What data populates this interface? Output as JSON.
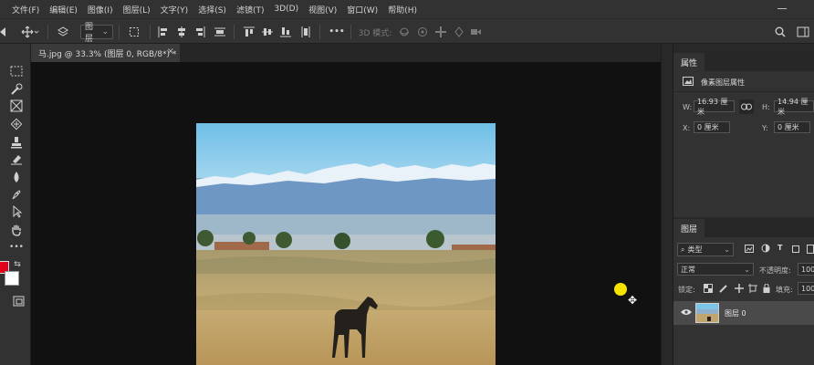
{
  "menubar": {
    "items": [
      "文件(F)",
      "编辑(E)",
      "图像(I)",
      "图层(L)",
      "文字(Y)",
      "选择(S)",
      "滤镜(T)",
      "3D(D)",
      "视图(V)",
      "窗口(W)",
      "帮助(H)"
    ]
  },
  "optionsbar": {
    "target_value": "图层",
    "mode_3d_label": "3D 模式:",
    "more_label": "•••"
  },
  "document": {
    "tab_title": "马.jpg @ 33.3% (图层 0, RGB/8*) *",
    "tab_close": "×"
  },
  "properties": {
    "tab_label": "属性",
    "section_label": "像素图层属性",
    "w_label": "W:",
    "w_value": "16.93 厘米",
    "h_label": "H:",
    "h_value": "14.94 厘米",
    "x_label": "X:",
    "x_value": "0 厘米",
    "y_label": "Y:",
    "y_value": "0 厘米"
  },
  "layers": {
    "tab_label": "图层",
    "filter_label": "类型",
    "blend_mode": "正常",
    "opacity_label": "不透明度:",
    "opacity_value": "100",
    "lock_label": "锁定:",
    "fill_label": "填充:",
    "fill_value": "100",
    "layer_name": "图层 0"
  },
  "colors": {
    "foreground": "#e3001b",
    "background": "#ffffff",
    "accent_cursor": "#f4e400"
  }
}
